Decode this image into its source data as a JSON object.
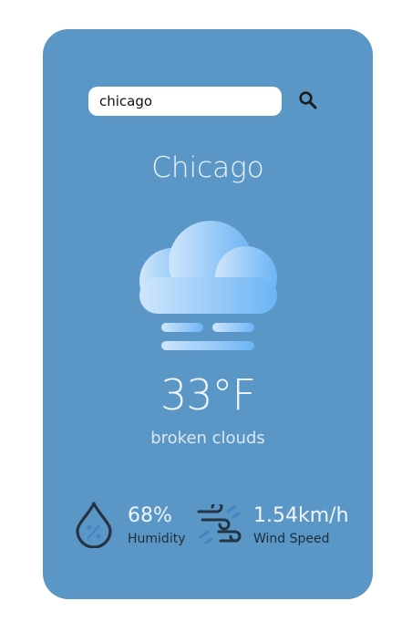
{
  "search": {
    "value": "chicago",
    "icon": "search-icon"
  },
  "weather": {
    "city": "Chicago",
    "condition_icon": "cloud-fog-icon",
    "temperature": "33°F",
    "description": "broken clouds"
  },
  "stats": {
    "humidity": {
      "icon": "humidity-drop-icon",
      "value": "68%",
      "label": "Humidity"
    },
    "wind": {
      "icon": "wind-icon",
      "value": "1.54km/h",
      "label": "Wind Speed"
    }
  },
  "colors": {
    "card_background": "#5b97c6",
    "cloud_light": "#cfe6fb",
    "cloud_dark": "#6cb4f5",
    "icon_dark": "#243444"
  }
}
